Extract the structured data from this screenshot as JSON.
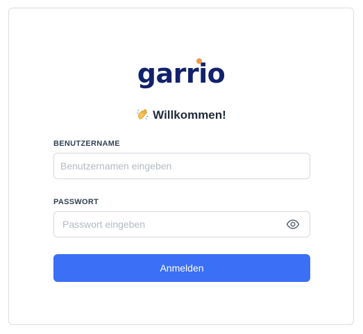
{
  "brand": {
    "logo_text": "garrio",
    "accent_color": "#f2994a",
    "primary_color": "#12216b"
  },
  "welcome": {
    "emoji": "waving-hand-icon",
    "text": "Willkommen!"
  },
  "form": {
    "username": {
      "label": "BENUTZERNAME",
      "value": "",
      "placeholder": "Benutzernamen eingeben"
    },
    "password": {
      "label": "PASSWORT",
      "value": "",
      "placeholder": "Passwort eingeben",
      "toggle_icon": "eye-icon"
    },
    "submit_label": "Anmelden",
    "submit_color": "#3b6ff5"
  }
}
